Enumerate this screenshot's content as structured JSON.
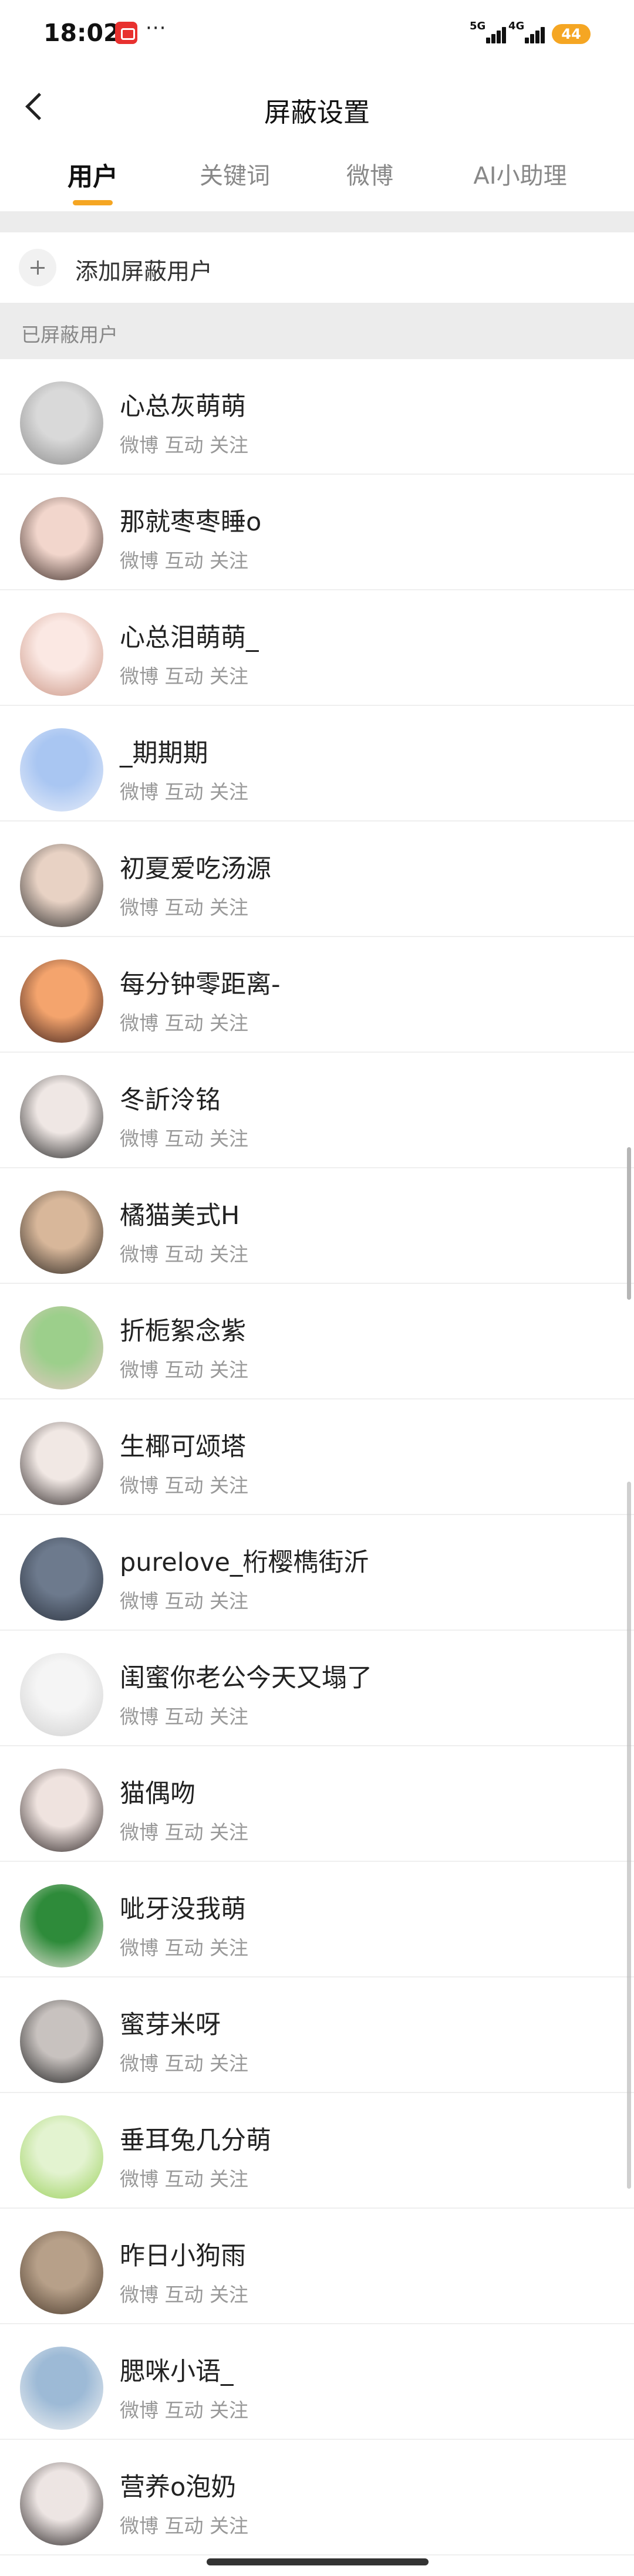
{
  "status_bar": {
    "time": "18:02",
    "more": "···",
    "signal_1": "5G",
    "signal_2": "4G",
    "battery": "44",
    "notif_icon": "app-notification-icon"
  },
  "header": {
    "title": "屏蔽设置",
    "back_icon": "chevron-left-icon"
  },
  "tabs": [
    {
      "label": "用户",
      "active": true
    },
    {
      "label": "关键词",
      "active": false
    },
    {
      "label": "微博",
      "active": false
    },
    {
      "label": "AI小助理",
      "active": false
    }
  ],
  "colors": {
    "accent": "#f5a623",
    "section_bg": "#ececec",
    "muted_text": "#999999"
  },
  "add_row": {
    "label": "添加屏蔽用户",
    "icon": "plus-icon"
  },
  "section": {
    "label": "已屏蔽用户"
  },
  "users": [
    {
      "name": "心总灰萌萌",
      "sub": "微博 互动 关注",
      "avatar_colors": [
        "#d9d9d9",
        "#8a8a8a"
      ]
    },
    {
      "name": "那就枣枣睡o",
      "sub": "微博 互动 关注",
      "avatar_colors": [
        "#f2d6cc",
        "#3a2a25"
      ]
    },
    {
      "name": "心总泪萌萌_",
      "sub": "微博 互动 关注",
      "avatar_colors": [
        "#fbe8e3",
        "#c99483"
      ]
    },
    {
      "name": "_期期期",
      "sub": "微博 互动 关注",
      "avatar_colors": [
        "#a9c6f2",
        "#e9eef9"
      ]
    },
    {
      "name": "初夏爱吃汤源",
      "sub": "微博 互动 关注",
      "avatar_colors": [
        "#e8d2c4",
        "#2b2b2b"
      ]
    },
    {
      "name": "每分钟零距离-",
      "sub": "微博 互动 关注",
      "avatar_colors": [
        "#f4a46d",
        "#3b1e1a"
      ]
    },
    {
      "name": "冬訢泠铭",
      "sub": "微博 互动 关注",
      "avatar_colors": [
        "#efe7e4",
        "#1e1e1e"
      ]
    },
    {
      "name": "橘猫美式H",
      "sub": "微博 互动 关注",
      "avatar_colors": [
        "#d8b79a",
        "#2a2520"
      ]
    },
    {
      "name": "折栀絮念紫",
      "sub": "微博 互动 关注",
      "avatar_colors": [
        "#9ccf8b",
        "#e7c8c5"
      ]
    },
    {
      "name": "生椰可颂塔",
      "sub": "微博 互动 关注",
      "avatar_colors": [
        "#f1e8e4",
        "#2c2525"
      ]
    },
    {
      "name": "purelove_桁樱檇街沂",
      "sub": "微博 互动 关注",
      "avatar_colors": [
        "#6d7a8d",
        "#2a313d"
      ]
    },
    {
      "name": "闺蜜你老公今天又塌了",
      "sub": "微博 互动 关注",
      "avatar_colors": [
        "#f5f5f5",
        "#cfcfcf"
      ]
    },
    {
      "name": "猫偶吻",
      "sub": "微博 互动 关注",
      "avatar_colors": [
        "#efe3df",
        "#2a2222"
      ]
    },
    {
      "name": "呲牙没我萌",
      "sub": "微博 互动 关注",
      "avatar_colors": [
        "#2e8b3a",
        "#e9e4da"
      ]
    },
    {
      "name": "蜜芽米呀",
      "sub": "微博 互动 关注",
      "avatar_colors": [
        "#c8c2bf",
        "#1c1c1c"
      ]
    },
    {
      "name": "垂耳兔几分萌",
      "sub": "微博 互动 关注",
      "avatar_colors": [
        "#e3f3d0",
        "#9ad05a"
      ]
    },
    {
      "name": "昨日小狗雨",
      "sub": "微博 互动 关注",
      "avatar_colors": [
        "#b7a089",
        "#4a3a2c"
      ]
    },
    {
      "name": "腮咪小语_",
      "sub": "微博 互动 关注",
      "avatar_colors": [
        "#9dbad6",
        "#f3f3f3"
      ]
    },
    {
      "name": "营养o泡奶",
      "sub": "微博 互动 关注",
      "avatar_colors": [
        "#ede5e3",
        "#252020"
      ]
    }
  ]
}
